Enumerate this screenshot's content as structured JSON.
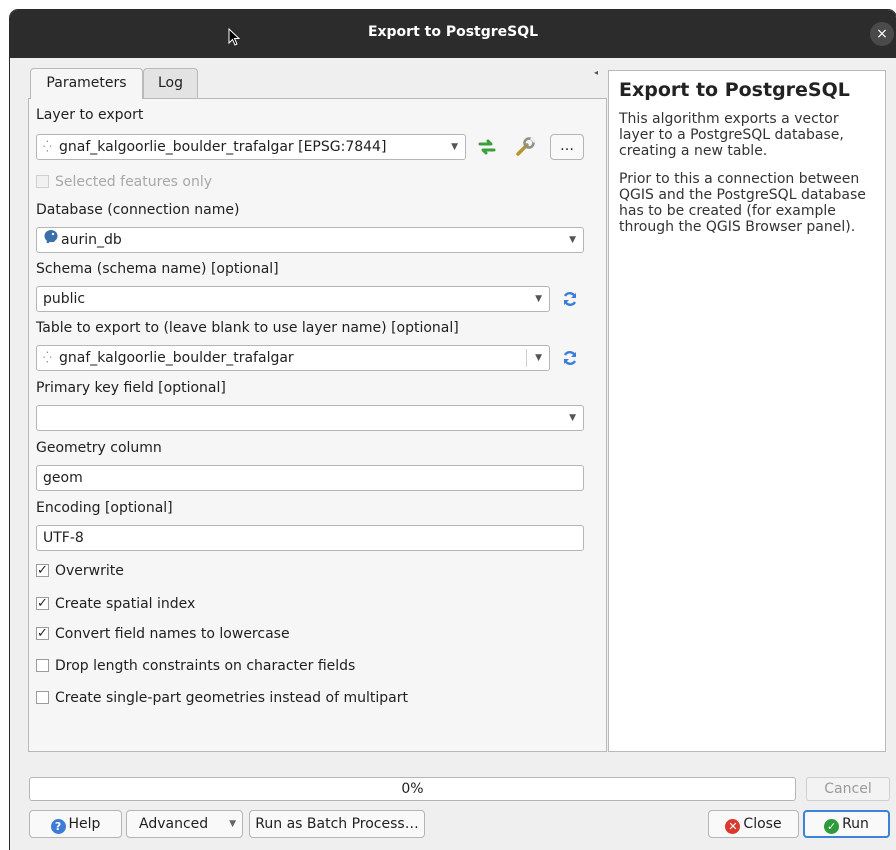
{
  "window": {
    "title": "Export to PostgreSQL",
    "close_label": "×"
  },
  "tabs": [
    {
      "label": "Parameters"
    },
    {
      "label": "Log"
    }
  ],
  "params": {
    "layer_label": "Layer to export",
    "layer_value": "gnaf_kalgoorlie_boulder_trafalgar [EPSG:7844]",
    "layer_more_label": "…",
    "selected_only_label": "Selected features only",
    "database_label": "Database (connection name)",
    "database_value": "aurin_db",
    "schema_label": "Schema (schema name) [optional]",
    "schema_value": "public",
    "table_label": "Table to export to (leave blank to use layer name) [optional]",
    "table_value": "gnaf_kalgoorlie_boulder_trafalgar",
    "pk_label": "Primary key field [optional]",
    "pk_value": "",
    "geom_label": "Geometry column",
    "geom_value": "geom",
    "encoding_label": "Encoding [optional]",
    "encoding_value": "UTF-8",
    "options": [
      {
        "label": "Overwrite",
        "checked": true
      },
      {
        "label": "Create spatial index",
        "checked": true
      },
      {
        "label": "Convert field names to lowercase",
        "checked": true
      },
      {
        "label": "Drop length constraints on character fields",
        "checked": false
      },
      {
        "label": "Create single-part geometries instead of multipart",
        "checked": false
      }
    ]
  },
  "help": {
    "title": "Export to PostgreSQL",
    "p1": "This algorithm exports a vector layer to a PostgreSQL database, creating a new table.",
    "p2": "Prior to this a connection between QGIS and the PostgreSQL database has to be created (for example through the QGIS Browser panel)."
  },
  "progress": {
    "text": "0%",
    "value": 0
  },
  "buttons": {
    "cancel": "Cancel",
    "help": "Help",
    "advanced": "Advanced",
    "batch": "Run as Batch Process…",
    "close": "Close",
    "run": "Run"
  },
  "colors": {
    "titlebar": "#2c2c2c",
    "help_badge": "#3d7bd8",
    "close_badge": "#d93a2e",
    "run_badge": "#2e9a3a",
    "run_border": "#3c82d6",
    "refresh": "#3b7dd8",
    "sync": "#3aa13a"
  }
}
